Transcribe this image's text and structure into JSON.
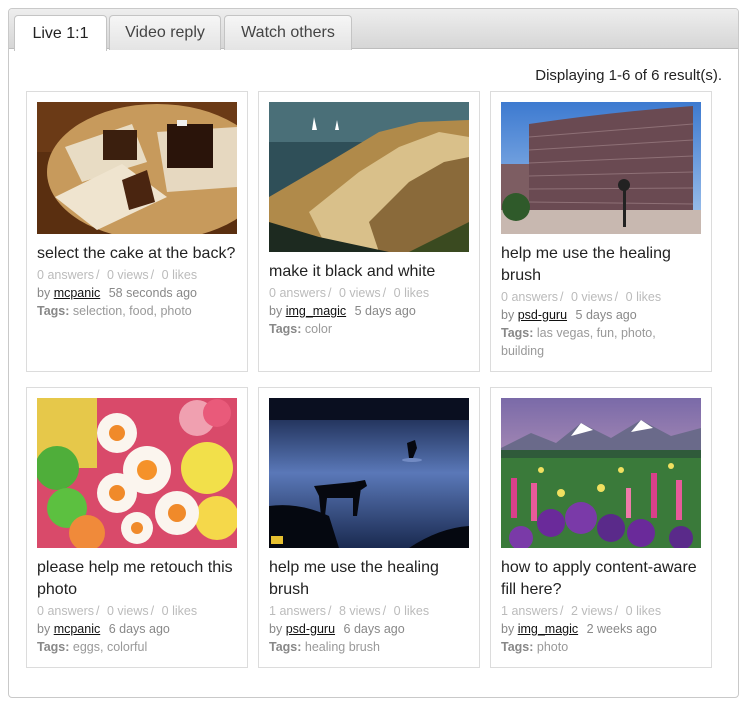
{
  "tabs": [
    {
      "label": "Live 1:1",
      "active": true
    },
    {
      "label": "Video reply",
      "active": false
    },
    {
      "label": "Watch others",
      "active": false
    }
  ],
  "results_text": "Displaying 1-6 of 6 result(s).",
  "stat_labels": {
    "answers": "answers",
    "views": "views",
    "likes": "likes"
  },
  "by_label": "by",
  "tags_label": "Tags:",
  "cards": [
    {
      "title": "select the cake at the back?",
      "answers": "0",
      "views": "0",
      "likes": "0",
      "user": "mcpanic",
      "time": "58 seconds ago",
      "tags": "selection, food, photo",
      "image": "dessert-plate-icon"
    },
    {
      "title": "make it black and white",
      "answers": "0",
      "views": "0",
      "likes": "0",
      "user": "img_magic",
      "time": "5 days ago",
      "tags": "color",
      "image": "coastal-cliff-icon"
    },
    {
      "title": "help me use the healing brush",
      "answers": "0",
      "views": "0",
      "likes": "0",
      "user": "psd-guru",
      "time": "5 days ago",
      "tags": "las vegas, fun, photo, building",
      "image": "hotel-tower-icon"
    },
    {
      "title": "please help me retouch this photo",
      "answers": "0",
      "views": "0",
      "likes": "0",
      "user": "mcpanic",
      "time": "6 days ago",
      "tags": "eggs, colorful",
      "image": "candy-eggs-icon"
    },
    {
      "title": "help me use the healing brush",
      "answers": "1",
      "views": "8",
      "likes": "0",
      "user": "psd-guru",
      "time": "6 days ago",
      "tags": "healing brush",
      "image": "moose-lake-icon"
    },
    {
      "title": "how to apply content-aware fill here?",
      "answers": "1",
      "views": "2",
      "likes": "0",
      "user": "img_magic",
      "time": "2 weeks ago",
      "tags": "photo",
      "image": "flower-field-icon"
    }
  ]
}
